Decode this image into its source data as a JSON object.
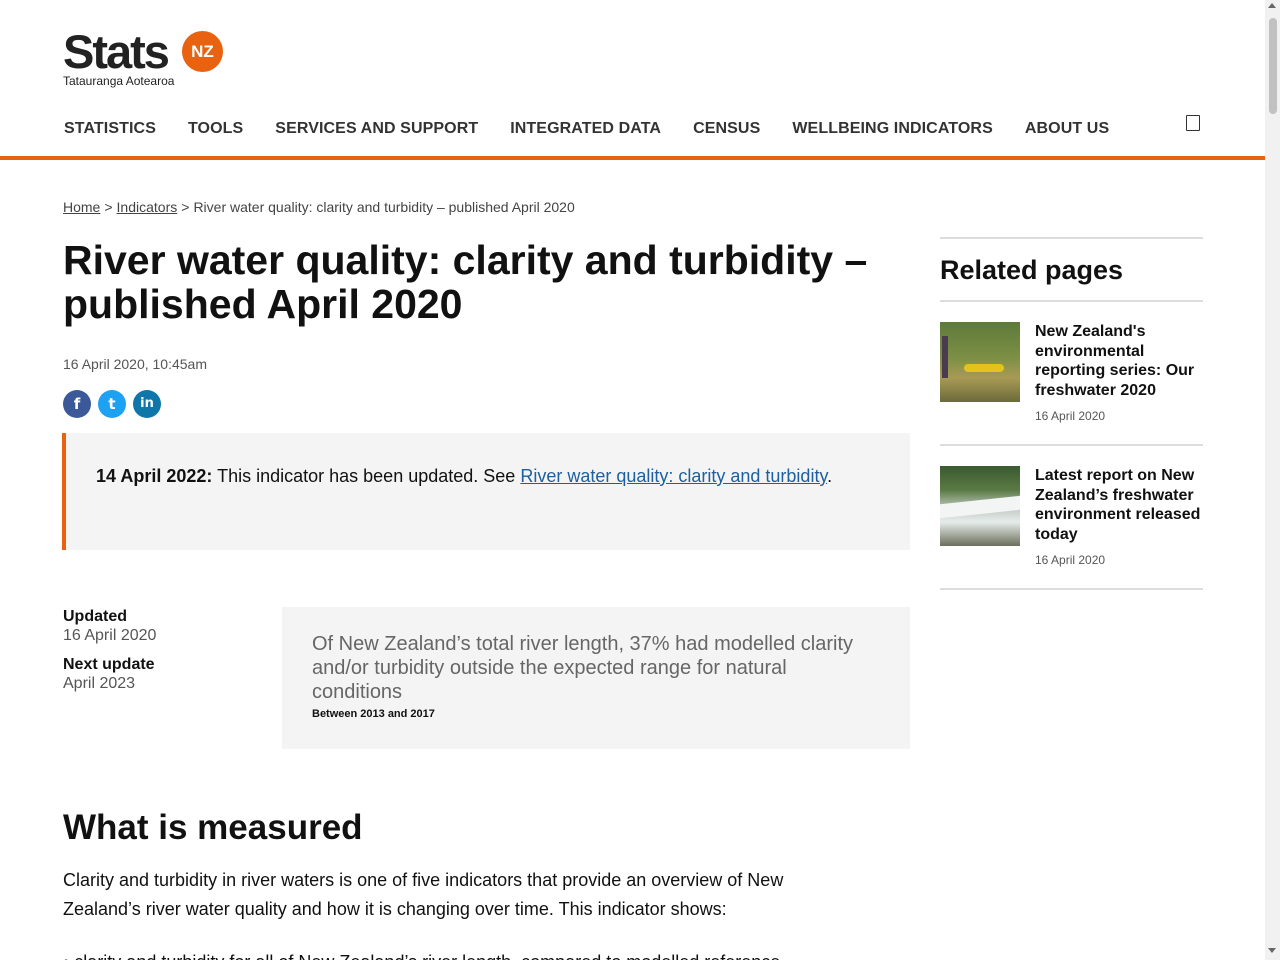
{
  "header": {
    "logo_word": "Stats",
    "logo_badge": "NZ",
    "logo_sub": "Tatauranga Aotearoa",
    "accent": "#e8620f",
    "nav": [
      "STATISTICS",
      "TOOLS",
      "SERVICES AND SUPPORT",
      "INTEGRATED DATA",
      "CENSUS",
      "WELLBEING INDICATORS",
      "ABOUT US"
    ],
    "search_icon": "search-icon"
  },
  "breadcrumb": {
    "home": "Home",
    "sep": ">",
    "indicators": "Indicators",
    "current": "River water quality: clarity and turbidity – published April 2020"
  },
  "page": {
    "title": "River water quality: clarity and turbidity – published April 2020",
    "date": "16 April 2020, 10:45am",
    "share": [
      "f",
      "t",
      "in"
    ]
  },
  "notice": {
    "date": "14 April 2022:",
    "text": "This indicator has been updated. See",
    "link": "River water quality: clarity and turbidity",
    "end": "."
  },
  "meta": {
    "updated_label": "Updated",
    "updated_value": "16 April 2020",
    "next_label": "Next update",
    "next_value": "April 2023"
  },
  "summary": {
    "text": "Of New Zealand’s total river length, 37% had modelled clarity and/or turbidity outside the expected range for natural conditions",
    "note": "Between 2013 and 2017"
  },
  "section": {
    "heading": "What is measured",
    "paragraph": "Clarity and turbidity in river waters is one of five indicators that provide an overview of New Zealand’s river water quality and how it is changing over time. This indicator shows:",
    "cut_line": "• clarity and turbidity for all of New Zealand’s river length, compared to modelled reference"
  },
  "related": {
    "heading": "Related pages",
    "items": [
      {
        "title": "New Zealand's environmental reporting series: Our freshwater 2020",
        "date": "16 April 2020"
      },
      {
        "title": "Latest report on New Zealand’s freshwater environment released today",
        "date": "16 April 2020"
      }
    ]
  }
}
